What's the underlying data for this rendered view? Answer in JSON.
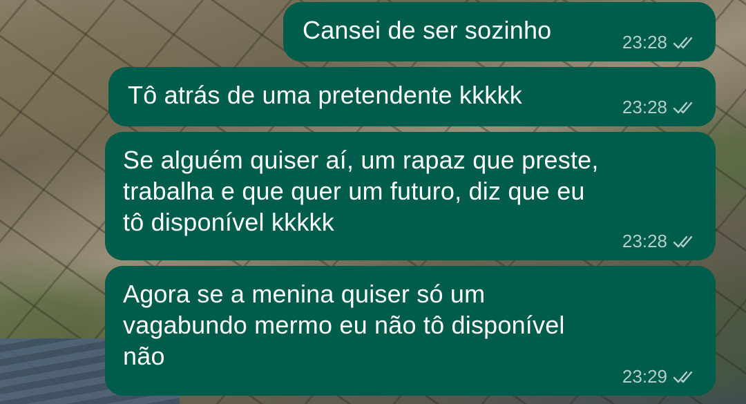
{
  "messages": [
    {
      "text": "Cansei de ser sozinho",
      "time": "23:28",
      "status_icon": "double-check-icon"
    },
    {
      "text": "Tô atrás de uma pretendente kkkkk",
      "time": "23:28",
      "status_icon": "double-check-icon"
    },
    {
      "text": "Se alguém quiser aí, um rapaz que preste,\ntrabalha e que quer um futuro, diz que eu\ntô disponível kkkkk",
      "time": "23:28",
      "status_icon": "double-check-icon"
    },
    {
      "text": "Agora se a menina quiser só um\nvagabundo mermo eu não tô disponível\nnão",
      "time": "23:29",
      "status_icon": "double-check-icon"
    }
  ],
  "colors": {
    "outgoing_bubble": "#005c4b",
    "text": "#ffffff",
    "timestamp": "#b3cfc9"
  }
}
